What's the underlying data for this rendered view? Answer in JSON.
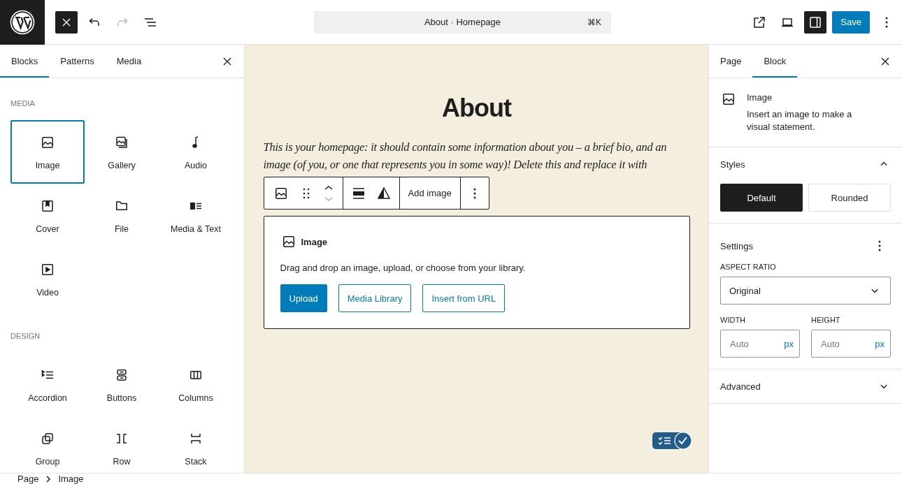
{
  "topbar": {
    "inserter_open": true,
    "redo_disabled": true,
    "document_title": "About · Homepage",
    "shortcut": "⌘K",
    "sidebar_open": true,
    "save": "Save"
  },
  "inserter": {
    "tabs": [
      {
        "label": "Blocks",
        "selected": true
      },
      {
        "label": "Patterns",
        "selected": false
      },
      {
        "label": "Media",
        "selected": false
      }
    ],
    "sections": [
      {
        "heading": "MEDIA",
        "blocks": [
          {
            "label": "Image",
            "selected": true
          },
          {
            "label": "Gallery",
            "selected": false
          },
          {
            "label": "Audio",
            "selected": false
          },
          {
            "label": "Cover",
            "selected": false
          },
          {
            "label": "File",
            "selected": false
          },
          {
            "label": "Media & Text",
            "selected": false
          },
          {
            "label": "Video",
            "selected": false
          }
        ]
      },
      {
        "heading": "DESIGN",
        "blocks": [
          {
            "label": "Accordion",
            "selected": false
          },
          {
            "label": "Buttons",
            "selected": false
          },
          {
            "label": "Columns",
            "selected": false
          },
          {
            "label": "Group",
            "selected": false
          },
          {
            "label": "Row",
            "selected": false
          },
          {
            "label": "Stack",
            "selected": false
          }
        ]
      }
    ]
  },
  "canvas": {
    "title": "About",
    "paragraph": "This is your homepage: it should contain some information about you – a brief bio, and an image (of you, or one that represents you in some way)! Delete this and replace it with",
    "toolbar": {
      "add_image": "Add image"
    },
    "placeholder": {
      "title": "Image",
      "instructions": "Drag and drop an image, upload, or choose from your library.",
      "buttons": [
        {
          "label": "Upload",
          "kind": "primary"
        },
        {
          "label": "Media Library",
          "kind": "secondary"
        },
        {
          "label": "Insert from URL",
          "kind": "secondary"
        }
      ]
    }
  },
  "settings_panel": {
    "tabs": [
      {
        "label": "Page",
        "selected": false
      },
      {
        "label": "Block",
        "selected": true
      }
    ],
    "block": {
      "name": "Image",
      "description": "Insert an image to make a visual statement."
    },
    "styles": {
      "title": "Styles",
      "expanded": true,
      "options": [
        {
          "label": "Default",
          "selected": true
        },
        {
          "label": "Rounded",
          "selected": false
        }
      ]
    },
    "settings": {
      "title": "Settings",
      "aspect_ratio": {
        "label": "ASPECT RATIO",
        "value": "Original"
      },
      "width": {
        "label": "WIDTH",
        "placeholder": "Auto",
        "unit": "px"
      },
      "height": {
        "label": "HEIGHT",
        "placeholder": "Auto",
        "unit": "px"
      }
    },
    "advanced": {
      "title": "Advanced",
      "expanded": false
    }
  },
  "breadcrumb": [
    "Page",
    "Image"
  ]
}
